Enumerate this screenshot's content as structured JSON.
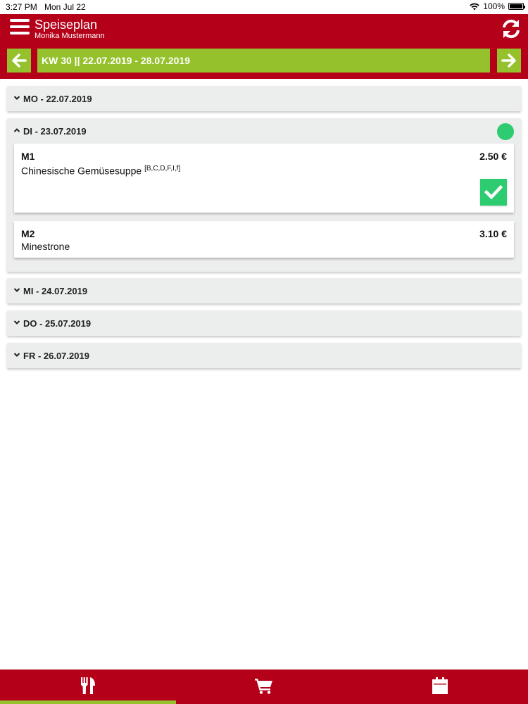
{
  "status_bar": {
    "time": "3:27 PM",
    "date": "Mon Jul 22",
    "battery": "100%",
    "icons": [
      "wifi-icon",
      "battery-icon"
    ]
  },
  "header": {
    "title": "Speiseplan",
    "user": "Monika Mustermann",
    "icons": [
      "menu-icon",
      "refresh-icon"
    ]
  },
  "week": {
    "label": "KW 30 || 22.07.2019 - 28.07.2019",
    "icons": [
      "arrow-left-icon",
      "arrow-right-icon"
    ]
  },
  "days": [
    {
      "label": "MO - 22.07.2019",
      "expanded": false
    },
    {
      "label": "DI - 23.07.2019",
      "expanded": true,
      "status_dot": true,
      "meals": [
        {
          "code": "M1",
          "name": "Chinesische Gemüsesuppe",
          "allergens": "[B,C,D,F,I,f]",
          "price": "2.50 €",
          "ordered": true
        },
        {
          "code": "M2",
          "name": "Minestrone",
          "allergens": "",
          "price": "3.10 €",
          "ordered": false
        }
      ]
    },
    {
      "label": "MI - 24.07.2019",
      "expanded": false
    },
    {
      "label": "DO - 25.07.2019",
      "expanded": false
    },
    {
      "label": "FR - 26.07.2019",
      "expanded": false
    }
  ],
  "tabs": [
    {
      "icon": "fork-knife-icon",
      "active": true
    },
    {
      "icon": "cart-icon",
      "active": false
    },
    {
      "icon": "calendar-icon",
      "active": false
    }
  ],
  "colors": {
    "brand_red": "#b5001a",
    "accent_green": "#95c12c",
    "success_green": "#2ecc71",
    "panel_grey": "#eceded"
  }
}
